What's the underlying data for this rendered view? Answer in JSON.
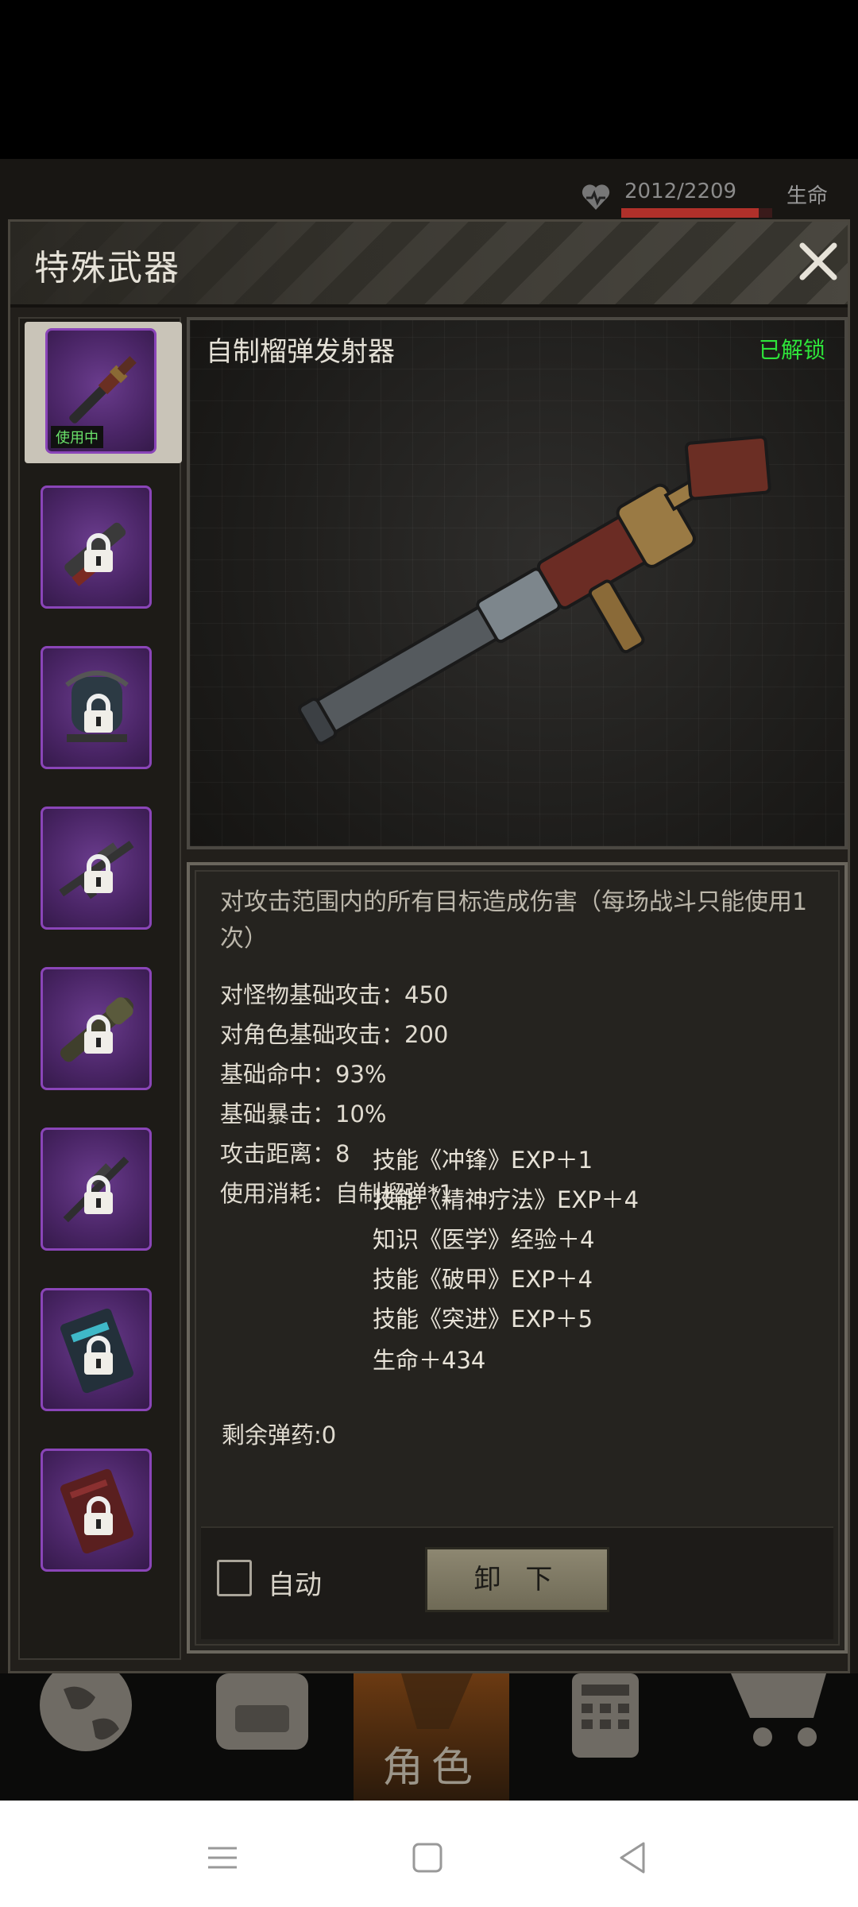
{
  "status": {
    "hp_text": "2012/2209",
    "hp_fraction": 0.91,
    "life_label": "生命"
  },
  "panel": {
    "title": "特殊武器",
    "close_icon": "close-icon"
  },
  "slots": [
    {
      "name": "grenade-launcher",
      "in_use_label": "使用中",
      "locked": false
    },
    {
      "name": "chainsaw",
      "locked": true
    },
    {
      "name": "flamethrower",
      "locked": true
    },
    {
      "name": "rifle-a",
      "locked": true
    },
    {
      "name": "rocket-launcher",
      "locked": true
    },
    {
      "name": "rifle-b",
      "locked": true
    },
    {
      "name": "device-blue",
      "locked": true
    },
    {
      "name": "device-red",
      "locked": true
    }
  ],
  "weapon": {
    "name": "自制榴弹发射器",
    "status": "已解锁",
    "description": "对攻击范围内的所有目标造成伤害（每场战斗只能使用1次）",
    "stats": [
      "对怪物基础攻击：450",
      "对角色基础攻击：200",
      "基础命中：93%",
      "基础暴击：10%",
      "攻击距离：8",
      "使用消耗：自制榴弹*1"
    ],
    "rewards": [
      "技能《冲锋》EXP＋1",
      "技能《精神疗法》EXP＋4",
      "知识《医学》经验＋4",
      "技能《破甲》EXP＋4",
      "技能《突进》EXP＋5",
      "生命＋434"
    ],
    "ammo": "剩余弹药:0"
  },
  "controls": {
    "auto_label": "自动",
    "unequip_label": "卸 下"
  },
  "nav": {
    "items": [
      "globe-icon",
      "backpack-icon",
      "character-icon",
      "calculator-icon",
      "cart-icon"
    ],
    "active_label": "角色"
  },
  "colors": {
    "unlocked": "#2ee43a",
    "slot_border": "#8a45b8",
    "hp_bar": "#b0302a"
  }
}
